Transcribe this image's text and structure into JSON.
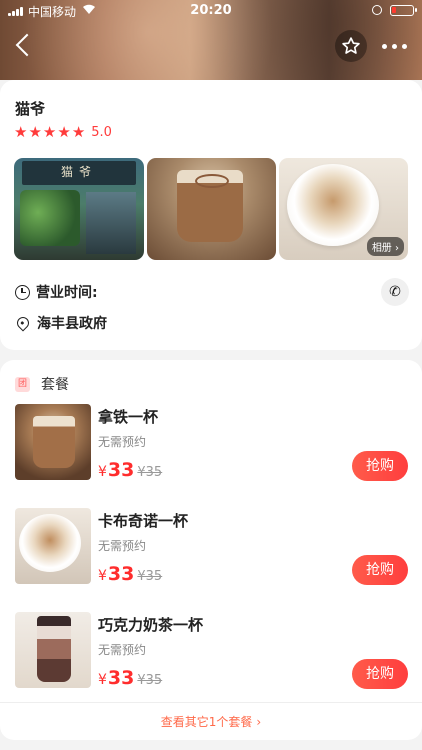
{
  "status_bar": {
    "carrier": "中国移动",
    "time": "20:20"
  },
  "store": {
    "name": "猫爷",
    "rating": "5.0",
    "stars": 5,
    "photo_sign": "猫爷",
    "album_label": "相册",
    "hours_label": "营业时间:",
    "address": "海丰县政府"
  },
  "package": {
    "title": "套餐",
    "icon_text": "团",
    "deals": [
      {
        "name": "拿铁一杯",
        "note": "无需预约",
        "currency": "¥",
        "price": "33",
        "original": "¥35",
        "button": "抢购"
      },
      {
        "name": "卡布奇诺一杯",
        "note": "无需预约",
        "currency": "¥",
        "price": "33",
        "original": "¥35",
        "button": "抢购"
      },
      {
        "name": "巧克力奶茶一杯",
        "note": "无需预约",
        "currency": "¥",
        "price": "33",
        "original": "¥35",
        "button": "抢购"
      }
    ],
    "more_label": "查看其它1个套餐"
  },
  "colors": {
    "accent": "#ff3b3b",
    "price": "#ff2d2d",
    "more_link": "#ff6a4a"
  },
  "icons": [
    "back-icon",
    "star-outline-icon",
    "more-icon",
    "clock-icon",
    "location-pin-icon",
    "phone-icon",
    "chevron-right-icon"
  ]
}
